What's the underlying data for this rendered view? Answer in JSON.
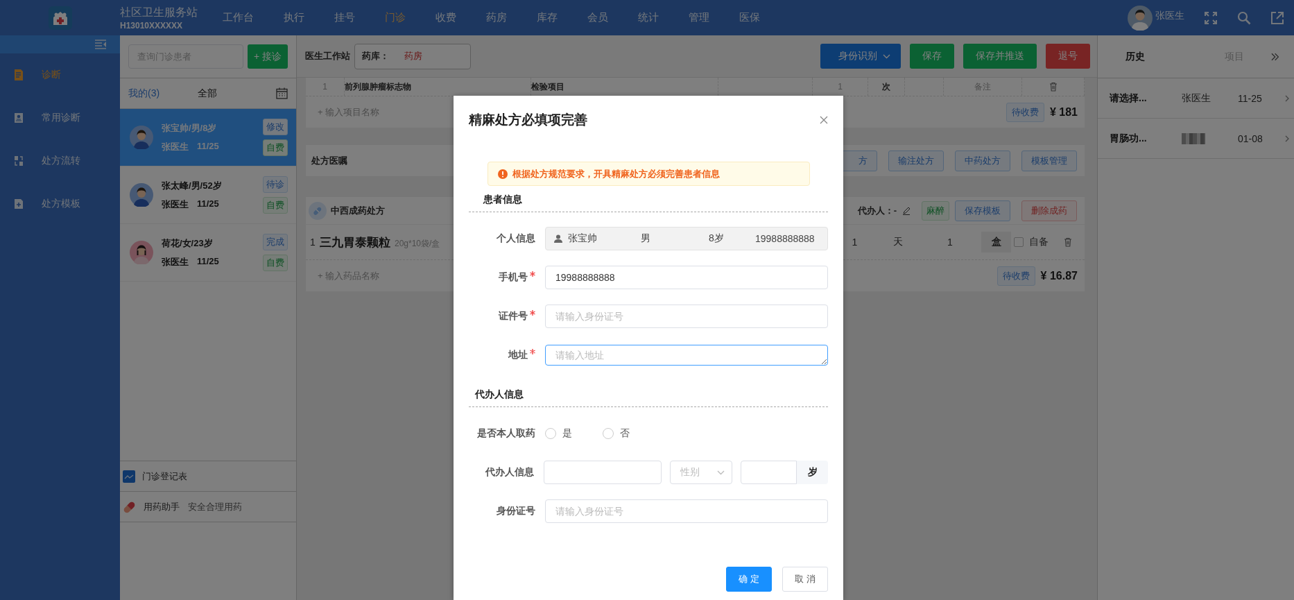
{
  "app": {
    "name": "社区卫生服务站",
    "code": "H13010XXXXXX"
  },
  "nav": [
    {
      "label": "工作台",
      "selected": false
    },
    {
      "label": "执行",
      "selected": false
    },
    {
      "label": "挂号",
      "selected": false
    },
    {
      "label": "门诊",
      "selected": true
    },
    {
      "label": "收费",
      "selected": false
    },
    {
      "label": "药房",
      "selected": false
    },
    {
      "label": "库存",
      "selected": false
    },
    {
      "label": "会员",
      "selected": false
    },
    {
      "label": "统计",
      "selected": false
    },
    {
      "label": "管理",
      "selected": false
    },
    {
      "label": "医保",
      "selected": false
    }
  ],
  "user": {
    "name": "张医生"
  },
  "sidebar": {
    "items": [
      {
        "label": "诊断",
        "selected": true
      },
      {
        "label": "常用诊断",
        "selected": false
      },
      {
        "label": "处方流转",
        "selected": false
      },
      {
        "label": "处方模板",
        "selected": false
      }
    ]
  },
  "patients_panel": {
    "search": {
      "placeholder": "查询门诊患者"
    },
    "add_button": "+ 接诊",
    "tabs": [
      {
        "label": "我的(3)",
        "selected": true
      },
      {
        "label": "全部",
        "selected": false
      }
    ],
    "patients": [
      {
        "info": "张宝帅/男/8岁",
        "doctor": "张医生",
        "date": "11/25",
        "status": "修改",
        "fee": "自费",
        "kind": "male",
        "selected": true
      },
      {
        "info": "张太峰/男/52岁",
        "doctor": "张医生",
        "date": "11/25",
        "status": "待诊",
        "fee": "自费",
        "kind": "male",
        "selected": false
      },
      {
        "info": "荷花/女/23岁",
        "doctor": "张医生",
        "date": "11/25",
        "status": "完成",
        "fee": "自费",
        "kind": "female",
        "selected": false
      }
    ],
    "tools": [
      {
        "kind": "chart",
        "label": "门诊登记表"
      },
      {
        "kind": "pill",
        "label": "用药助手",
        "hint": "安全合理用药"
      }
    ]
  },
  "workstation": {
    "title": "医生工作站",
    "pharmacy_label": "药库：",
    "pharmacy": "药房",
    "buttons": [
      {
        "label": "身份识别",
        "kind": "dropdown"
      },
      {
        "label": "保存",
        "kind": "success"
      },
      {
        "label": "保存并推送",
        "kind": "success"
      },
      {
        "label": "退号",
        "kind": "danger"
      }
    ]
  },
  "exam_items": {
    "rows": [
      {
        "index": "1",
        "name": "前列腺肿瘤标志物",
        "type": "检验项目",
        "qty": "1",
        "unit": "次",
        "remark": "备注"
      }
    ],
    "add_placeholder": "+ 输入项目名称",
    "status": "待收费",
    "total": "¥ 181"
  },
  "orders": {
    "title": "处方医嘱",
    "buttons": [
      "方",
      "输注处方",
      "中药处方",
      "模板管理"
    ]
  },
  "prescription": {
    "title": "中西成药处方",
    "agent_label": "代办人：-",
    "tag": "麻醉",
    "buttons": [
      {
        "label": "保存模板",
        "kind": "primary"
      },
      {
        "label": "删除成药",
        "kind": "danger"
      }
    ],
    "rows": [
      {
        "index": "1",
        "name": "三九胃泰颗粒",
        "spec": "20g*10袋/盒",
        "days": "1",
        "day_unit": "天",
        "qty": "1",
        "unit": "盒",
        "self_supplied": false,
        "self_label": "自备"
      }
    ],
    "add_placeholder": "+ 输入药品名称",
    "status": "待收费",
    "total": "¥ 16.87"
  },
  "history_panel": {
    "tabs": [
      {
        "label": "历史",
        "selected": true
      },
      {
        "label": "项目",
        "selected": false
      }
    ],
    "records": [
      {
        "title": "请选择...",
        "doctor": "张医生",
        "doctor_blurred": false,
        "date": "11-25"
      },
      {
        "title": "胃肠功...",
        "doctor_blurred": true,
        "date": "01-08"
      }
    ]
  },
  "dialog": {
    "title": "精麻处方必填项完善",
    "alert": "根据处方规范要求，开具精麻处方必须完善患者信息",
    "sections": [
      {
        "title": "患者信息",
        "fields": [
          {
            "kind": "readonly",
            "label": "个人信息",
            "required": false,
            "values": [
              "张宝帅",
              "男",
              "8岁",
              "19988888888"
            ]
          },
          {
            "kind": "input",
            "label": "手机号",
            "required": true,
            "value": "19988888888"
          },
          {
            "kind": "input",
            "label": "证件号",
            "required": true,
            "placeholder": "请输入身份证号"
          },
          {
            "kind": "textarea",
            "label": "地址",
            "required": true,
            "focused": true,
            "placeholder": "请输入地址"
          }
        ]
      },
      {
        "title": "代办人信息",
        "fields": [
          {
            "kind": "radio",
            "label": "是否本人取药",
            "required": false,
            "options": [
              {
                "label": "是",
                "selected": false
              },
              {
                "label": "否",
                "selected": false
              }
            ]
          },
          {
            "kind": "agent",
            "label": "代办人信息",
            "required": false,
            "select_placeholder": "性别",
            "age_unit": "岁"
          },
          {
            "kind": "input",
            "label": "身份证号",
            "required": false,
            "placeholder": "请输入身份证号"
          }
        ]
      }
    ],
    "buttons": [
      {
        "label": "确 定",
        "kind": "primary"
      },
      {
        "label": "取 消",
        "kind": "default"
      }
    ]
  }
}
